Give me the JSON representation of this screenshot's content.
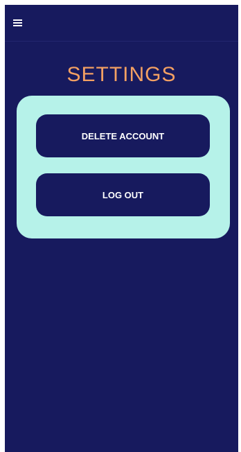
{
  "appbar": {
    "menu_icon": "hamburger-menu-icon"
  },
  "page": {
    "title": "SETTINGS"
  },
  "actions": {
    "delete_account_label": "DELETE ACCOUNT",
    "logout_label": "LOG OUT"
  },
  "colors": {
    "background": "#171a5e",
    "title": "#f3a063",
    "card": "#b6f2e9",
    "button_text": "#ffffff"
  }
}
